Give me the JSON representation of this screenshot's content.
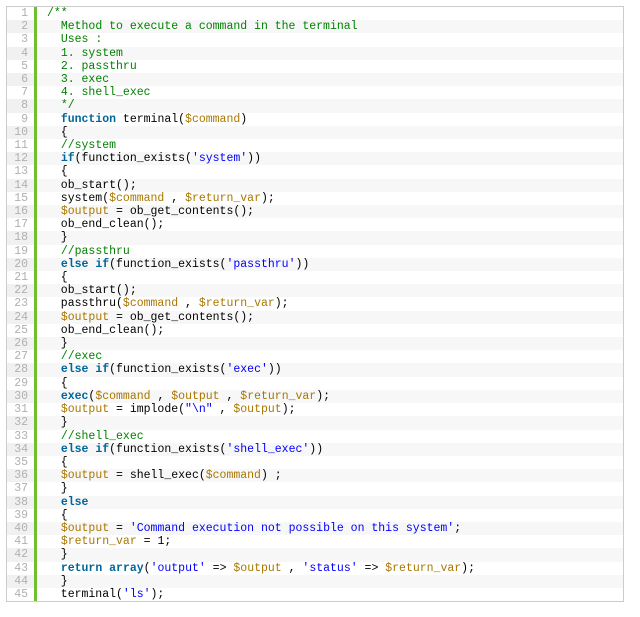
{
  "code": {
    "lines": [
      [
        {
          "t": "comment",
          "v": "/**"
        }
      ],
      [
        {
          "t": "plain",
          "v": "  "
        },
        {
          "t": "comment",
          "v": "Method to execute a command in the terminal"
        }
      ],
      [
        {
          "t": "plain",
          "v": "  "
        },
        {
          "t": "comment",
          "v": "Uses :"
        }
      ],
      [
        {
          "t": "plain",
          "v": "  "
        },
        {
          "t": "comment",
          "v": "1. system"
        }
      ],
      [
        {
          "t": "plain",
          "v": "  "
        },
        {
          "t": "comment",
          "v": "2. passthru"
        }
      ],
      [
        {
          "t": "plain",
          "v": "  "
        },
        {
          "t": "comment",
          "v": "3. exec"
        }
      ],
      [
        {
          "t": "plain",
          "v": "  "
        },
        {
          "t": "comment",
          "v": "4. shell_exec"
        }
      ],
      [
        {
          "t": "plain",
          "v": "  "
        },
        {
          "t": "comment",
          "v": "*/"
        }
      ],
      [
        {
          "t": "plain",
          "v": "  "
        },
        {
          "t": "keyword",
          "v": "function"
        },
        {
          "t": "plain",
          "v": " terminal("
        },
        {
          "t": "variable",
          "v": "$command"
        },
        {
          "t": "plain",
          "v": ")"
        }
      ],
      [
        {
          "t": "plain",
          "v": "  {"
        }
      ],
      [
        {
          "t": "plain",
          "v": "  "
        },
        {
          "t": "comment",
          "v": "//system"
        }
      ],
      [
        {
          "t": "plain",
          "v": "  "
        },
        {
          "t": "keyword",
          "v": "if"
        },
        {
          "t": "plain",
          "v": "(function_exists("
        },
        {
          "t": "string",
          "v": "'system'"
        },
        {
          "t": "plain",
          "v": "))"
        }
      ],
      [
        {
          "t": "plain",
          "v": "  {"
        }
      ],
      [
        {
          "t": "plain",
          "v": "  ob_start();"
        }
      ],
      [
        {
          "t": "plain",
          "v": "  system("
        },
        {
          "t": "variable",
          "v": "$command"
        },
        {
          "t": "plain",
          "v": " , "
        },
        {
          "t": "variable",
          "v": "$return_var"
        },
        {
          "t": "plain",
          "v": ");"
        }
      ],
      [
        {
          "t": "plain",
          "v": "  "
        },
        {
          "t": "variable",
          "v": "$output"
        },
        {
          "t": "plain",
          "v": " = ob_get_contents();"
        }
      ],
      [
        {
          "t": "plain",
          "v": "  ob_end_clean();"
        }
      ],
      [
        {
          "t": "plain",
          "v": "  }"
        }
      ],
      [
        {
          "t": "plain",
          "v": "  "
        },
        {
          "t": "comment",
          "v": "//passthru"
        }
      ],
      [
        {
          "t": "plain",
          "v": "  "
        },
        {
          "t": "keyword",
          "v": "else"
        },
        {
          "t": "plain",
          "v": " "
        },
        {
          "t": "keyword",
          "v": "if"
        },
        {
          "t": "plain",
          "v": "(function_exists("
        },
        {
          "t": "string",
          "v": "'passthru'"
        },
        {
          "t": "plain",
          "v": "))"
        }
      ],
      [
        {
          "t": "plain",
          "v": "  {"
        }
      ],
      [
        {
          "t": "plain",
          "v": "  ob_start();"
        }
      ],
      [
        {
          "t": "plain",
          "v": "  passthru("
        },
        {
          "t": "variable",
          "v": "$command"
        },
        {
          "t": "plain",
          "v": " , "
        },
        {
          "t": "variable",
          "v": "$return_var"
        },
        {
          "t": "plain",
          "v": ");"
        }
      ],
      [
        {
          "t": "plain",
          "v": "  "
        },
        {
          "t": "variable",
          "v": "$output"
        },
        {
          "t": "plain",
          "v": " = ob_get_contents();"
        }
      ],
      [
        {
          "t": "plain",
          "v": "  ob_end_clean();"
        }
      ],
      [
        {
          "t": "plain",
          "v": "  }"
        }
      ],
      [
        {
          "t": "plain",
          "v": "  "
        },
        {
          "t": "comment",
          "v": "//exec"
        }
      ],
      [
        {
          "t": "plain",
          "v": "  "
        },
        {
          "t": "keyword",
          "v": "else"
        },
        {
          "t": "plain",
          "v": " "
        },
        {
          "t": "keyword",
          "v": "if"
        },
        {
          "t": "plain",
          "v": "(function_exists("
        },
        {
          "t": "string",
          "v": "'exec'"
        },
        {
          "t": "plain",
          "v": "))"
        }
      ],
      [
        {
          "t": "plain",
          "v": "  {"
        }
      ],
      [
        {
          "t": "plain",
          "v": "  "
        },
        {
          "t": "keyword",
          "v": "exec"
        },
        {
          "t": "plain",
          "v": "("
        },
        {
          "t": "variable",
          "v": "$command"
        },
        {
          "t": "plain",
          "v": " , "
        },
        {
          "t": "variable",
          "v": "$output"
        },
        {
          "t": "plain",
          "v": " , "
        },
        {
          "t": "variable",
          "v": "$return_var"
        },
        {
          "t": "plain",
          "v": ");"
        }
      ],
      [
        {
          "t": "plain",
          "v": "  "
        },
        {
          "t": "variable",
          "v": "$output"
        },
        {
          "t": "plain",
          "v": " = implode("
        },
        {
          "t": "string",
          "v": "\"\\n\""
        },
        {
          "t": "plain",
          "v": " , "
        },
        {
          "t": "variable",
          "v": "$output"
        },
        {
          "t": "plain",
          "v": ");"
        }
      ],
      [
        {
          "t": "plain",
          "v": "  }"
        }
      ],
      [
        {
          "t": "plain",
          "v": "  "
        },
        {
          "t": "comment",
          "v": "//shell_exec"
        }
      ],
      [
        {
          "t": "plain",
          "v": "  "
        },
        {
          "t": "keyword",
          "v": "else"
        },
        {
          "t": "plain",
          "v": " "
        },
        {
          "t": "keyword",
          "v": "if"
        },
        {
          "t": "plain",
          "v": "(function_exists("
        },
        {
          "t": "string",
          "v": "'shell_exec'"
        },
        {
          "t": "plain",
          "v": "))"
        }
      ],
      [
        {
          "t": "plain",
          "v": "  {"
        }
      ],
      [
        {
          "t": "plain",
          "v": "  "
        },
        {
          "t": "variable",
          "v": "$output"
        },
        {
          "t": "plain",
          "v": " = shell_exec("
        },
        {
          "t": "variable",
          "v": "$command"
        },
        {
          "t": "plain",
          "v": ") ;"
        }
      ],
      [
        {
          "t": "plain",
          "v": "  }"
        }
      ],
      [
        {
          "t": "plain",
          "v": "  "
        },
        {
          "t": "keyword",
          "v": "else"
        }
      ],
      [
        {
          "t": "plain",
          "v": "  {"
        }
      ],
      [
        {
          "t": "plain",
          "v": "  "
        },
        {
          "t": "variable",
          "v": "$output"
        },
        {
          "t": "plain",
          "v": " = "
        },
        {
          "t": "string",
          "v": "'Command execution not possible on this system'"
        },
        {
          "t": "plain",
          "v": ";"
        }
      ],
      [
        {
          "t": "plain",
          "v": "  "
        },
        {
          "t": "variable",
          "v": "$return_var"
        },
        {
          "t": "plain",
          "v": " = 1;"
        }
      ],
      [
        {
          "t": "plain",
          "v": "  }"
        }
      ],
      [
        {
          "t": "plain",
          "v": "  "
        },
        {
          "t": "keyword",
          "v": "return"
        },
        {
          "t": "plain",
          "v": " "
        },
        {
          "t": "keyword",
          "v": "array"
        },
        {
          "t": "plain",
          "v": "("
        },
        {
          "t": "string",
          "v": "'output'"
        },
        {
          "t": "plain",
          "v": " => "
        },
        {
          "t": "variable",
          "v": "$output"
        },
        {
          "t": "plain",
          "v": " , "
        },
        {
          "t": "string",
          "v": "'status'"
        },
        {
          "t": "plain",
          "v": " => "
        },
        {
          "t": "variable",
          "v": "$return_var"
        },
        {
          "t": "plain",
          "v": ");"
        }
      ],
      [
        {
          "t": "plain",
          "v": "  }"
        }
      ],
      [
        {
          "t": "plain",
          "v": "  terminal("
        },
        {
          "t": "string",
          "v": "'ls'"
        },
        {
          "t": "plain",
          "v": ");"
        }
      ]
    ]
  }
}
